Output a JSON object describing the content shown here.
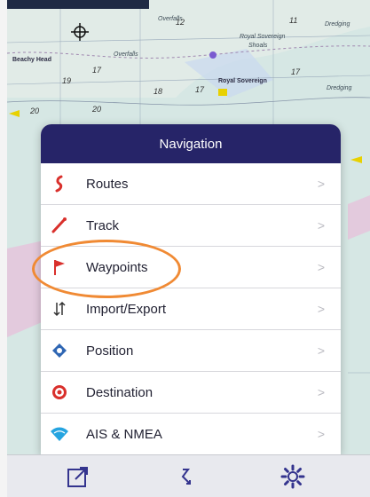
{
  "map": {
    "labels": [
      "Royal Sovereign",
      "Shoals",
      "Royal Sovereign",
      "Dredging",
      "Overfalls",
      "Beachy Head",
      "Dredging",
      "Overfalls"
    ],
    "depths": [
      "12",
      "11",
      "17",
      "19",
      "18",
      "17",
      "20",
      "20",
      "17"
    ]
  },
  "panel": {
    "title": "Navigation",
    "items": [
      {
        "label": "Routes",
        "icon": "routes-icon",
        "color": "#d9302c"
      },
      {
        "label": "Track",
        "icon": "track-icon",
        "color": "#d9302c"
      },
      {
        "label": "Waypoints",
        "icon": "flag-icon",
        "color": "#d9302c"
      },
      {
        "label": "Import/Export",
        "icon": "import-export-icon",
        "color": "#333333"
      },
      {
        "label": "Position",
        "icon": "position-icon",
        "color": "#2f66b3"
      },
      {
        "label": "Destination",
        "icon": "destination-icon",
        "color": "#d9302c"
      },
      {
        "label": "AIS & NMEA",
        "icon": "wifi-icon",
        "color": "#25a4e0"
      }
    ]
  },
  "toolbar": {
    "buttons": [
      {
        "icon": "share-icon"
      },
      {
        "icon": "route-arrow-icon"
      },
      {
        "icon": "gear-icon"
      }
    ]
  },
  "colors": {
    "header": "#262468",
    "accent": "#34348e",
    "highlight": "#f08a34"
  }
}
